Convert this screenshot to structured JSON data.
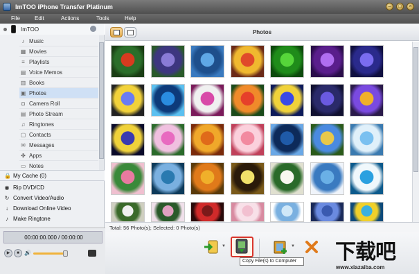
{
  "window": {
    "title": "ImTOO iPhone Transfer Platinum"
  },
  "menu": [
    "File",
    "Edit",
    "Actions",
    "Tools",
    "Help"
  ],
  "device": {
    "name": "ImTOO"
  },
  "sidebar": {
    "items": [
      {
        "label": "Music",
        "icon": "music-icon"
      },
      {
        "label": "Movies",
        "icon": "movie-icon"
      },
      {
        "label": "Playlists",
        "icon": "playlist-icon"
      },
      {
        "label": "Voice Memos",
        "icon": "voice-memo-icon"
      },
      {
        "label": "Books",
        "icon": "book-icon"
      },
      {
        "label": "Photos",
        "icon": "photo-icon",
        "selected": true
      },
      {
        "label": "Camera Roll",
        "icon": "camera-icon"
      },
      {
        "label": "Photo Stream",
        "icon": "photo-stream-icon"
      },
      {
        "label": "Ringtones",
        "icon": "bell-icon"
      },
      {
        "label": "Contacts",
        "icon": "contacts-icon"
      },
      {
        "label": "Messages",
        "icon": "message-icon"
      },
      {
        "label": "Apps",
        "icon": "apps-icon"
      },
      {
        "label": "Notes",
        "icon": "notes-icon"
      }
    ],
    "cache": "My Cache (0)",
    "tools": [
      "Rip DVD/CD",
      "Convert Video/Audio",
      "Download Online Video",
      "Make Ringtone"
    ]
  },
  "player": {
    "time": "00:00:00.000 / 00:00:00"
  },
  "main": {
    "title": "Photos",
    "status": "Total: 56 Photo(s); Selected: 0 Photo(s)",
    "tooltip": "Copy File(s) to Computer"
  },
  "watermark": {
    "big": "下载吧",
    "small": "www.xiazaiba.com"
  },
  "colors": {
    "accent": "#e0a74a",
    "selection": "#cfe0f5",
    "highlight_border": "#d9352b"
  },
  "photos": [
    {
      "a": "#d83a1f",
      "b": "#2b6e2a",
      "c": "#1a3d14"
    },
    {
      "a": "#8a7bd6",
      "b": "#3d3680",
      "c": "#2a5a2a"
    },
    {
      "a": "#5fa8e6",
      "b": "#1e4f8c",
      "c": "#3a7abf"
    },
    {
      "a": "#e04a2a",
      "b": "#f0b92f",
      "c": "#6b2a18"
    },
    {
      "a": "#56d63a",
      "b": "#1f8c1a",
      "c": "#0d4a0d"
    },
    {
      "a": "#b06ef0",
      "b": "#5a1e8c",
      "c": "#2a0d4a"
    },
    {
      "a": "#7a6cf0",
      "b": "#2a2a8c",
      "c": "#101040"
    },
    {
      "a": "#6a7cf2",
      "b": "#f2d23a",
      "c": "#222"
    },
    {
      "a": "#2a8ce0",
      "b": "#0d3a7a",
      "c": "#5bc0f0"
    },
    {
      "a": "#d84aa8",
      "b": "#f0f0f0",
      "c": "#7a1a5a"
    },
    {
      "a": "#e6402a",
      "b": "#f08a2a",
      "c": "#1a4a1a"
    },
    {
      "a": "#3a4ae6",
      "b": "#f0d23a",
      "c": "#0d1a5a"
    },
    {
      "a": "#6a5ae0",
      "b": "#2a2a6a",
      "c": "#101030"
    },
    {
      "a": "#f0b02a",
      "b": "#7a4ae0",
      "c": "#2a1a4a"
    },
    {
      "a": "#3a3ab0",
      "b": "#f0d23a",
      "c": "#0a0a2a"
    },
    {
      "a": "#e86ac0",
      "b": "#f0c0e0",
      "c": "#2a6a2a"
    },
    {
      "a": "#e06a1a",
      "b": "#f0a82a",
      "c": "#7a2a0a"
    },
    {
      "a": "#f28aa0",
      "b": "#fbd0dc",
      "c": "#c0405a"
    },
    {
      "a": "#1f5aa8",
      "b": "#0d2a5a",
      "c": "#6aa8e6"
    },
    {
      "a": "#e8c84a",
      "b": "#4a8ae0",
      "c": "#2a5a1a"
    },
    {
      "a": "#7ac0f0",
      "b": "#e0f0fa",
      "c": "#3a7ab0"
    },
    {
      "a": "#e87aa0",
      "b": "#3a8a3a",
      "c": "#f0c0d0"
    },
    {
      "a": "#2a7ab0",
      "b": "#7ab0e0",
      "c": "#0d3a5a"
    },
    {
      "a": "#f0b02a",
      "b": "#e07a1a",
      "c": "#5a3a0a"
    },
    {
      "a": "#f0e06a",
      "b": "#2a1a0a",
      "c": "#7a5a1a"
    },
    {
      "a": "#f8f8f0",
      "b": "#2a6a2a",
      "c": "#e0e0d0"
    },
    {
      "a": "#6ab0e6",
      "b": "#3a7ac0",
      "c": "#f0f4fa"
    },
    {
      "a": "#2aa0e0",
      "b": "#f0f8fc",
      "c": "#0d5a8c"
    },
    {
      "a": "#f0f0f0",
      "b": "#3a6a2a",
      "c": "#cfcfc0"
    },
    {
      "a": "#e0a0c0",
      "b": "#2a5a2a",
      "c": "#f0e0ea"
    },
    {
      "a": "#7a1a1a",
      "b": "#d02a2a",
      "c": "#2a0a0a"
    },
    {
      "a": "#f2c0d0",
      "b": "#f8e0e8",
      "c": "#d88aa0"
    },
    {
      "a": "#d0e8f8",
      "b": "#7ab0e0",
      "c": "#fff"
    },
    {
      "a": "#3a5ab0",
      "b": "#6a8ae0",
      "c": "#1a2a5a"
    },
    {
      "a": "#3ab0e0",
      "b": "#f0d02a",
      "c": "#0d4a7a"
    }
  ]
}
